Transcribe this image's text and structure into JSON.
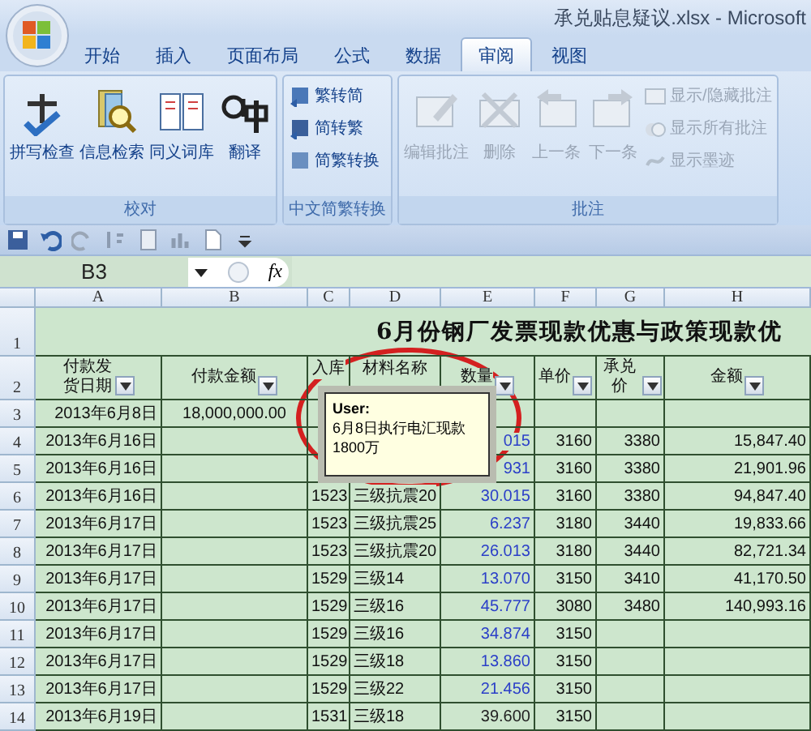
{
  "window": {
    "title": "承兑贴息疑议.xlsx - Microsoft"
  },
  "tabs": [
    {
      "label": "开始",
      "selected": false
    },
    {
      "label": "插入",
      "selected": false
    },
    {
      "label": "页面布局",
      "selected": false
    },
    {
      "label": "公式",
      "selected": false
    },
    {
      "label": "数据",
      "selected": false
    },
    {
      "label": "审阅",
      "selected": true
    },
    {
      "label": "视图",
      "selected": false
    }
  ],
  "ribbon": {
    "groups": [
      {
        "label": "校对",
        "large": [
          {
            "label": "拼写检查",
            "disabled": false
          },
          {
            "label": "信息检索",
            "disabled": false
          },
          {
            "label": "同义词库",
            "disabled": false
          },
          {
            "label": "翻译",
            "disabled": false
          }
        ]
      },
      {
        "label": "中文简繁转换",
        "small": [
          {
            "label": "繁转简",
            "disabled": false
          },
          {
            "label": "简转繁",
            "disabled": false
          },
          {
            "label": "简繁转换",
            "disabled": false
          }
        ]
      },
      {
        "label": "批注",
        "large": [
          {
            "label": "编辑批注",
            "disabled": true
          },
          {
            "label": "删除",
            "disabled": true
          },
          {
            "label": "上一条",
            "disabled": true
          },
          {
            "label": "下一条",
            "disabled": true
          }
        ],
        "small": [
          {
            "label": "显示/隐藏批注",
            "disabled": true
          },
          {
            "label": "显示所有批注",
            "disabled": true
          },
          {
            "label": "显示墨迹",
            "disabled": true
          }
        ]
      }
    ]
  },
  "formula_bar": {
    "name_box": "B3",
    "fx": "fx"
  },
  "sheet": {
    "columns": [
      "A",
      "B",
      "C",
      "D",
      "E",
      "F",
      "G",
      "H"
    ],
    "title_row": {
      "num": "1",
      "text": "6月份钢厂发票现款优惠与政策现款优"
    },
    "header_row": {
      "num": "2",
      "cells": [
        {
          "text": "付款发货日期",
          "filter": true
        },
        {
          "text": "付款金额",
          "filter": true
        },
        {
          "text": "入库",
          "filter": false
        },
        {
          "text": "材料名称",
          "filter": false
        },
        {
          "text": "数量",
          "filter": true
        },
        {
          "text": "单价",
          "filter": true
        },
        {
          "text": "承兑价",
          "filter": true
        },
        {
          "text": "金额",
          "filter": true
        }
      ]
    },
    "rows": [
      {
        "num": "3",
        "cells": [
          "2013年6月8日",
          "18,000,000.00",
          "",
          "",
          "",
          "",
          "",
          ""
        ]
      },
      {
        "num": "4",
        "cells": [
          "2013年6月16日",
          "",
          "",
          "",
          "015",
          "3160",
          "3380",
          "15,847.40"
        ],
        "quantity_highlighted": true
      },
      {
        "num": "5",
        "cells": [
          "2013年6月16日",
          "",
          "",
          "",
          "931",
          "3160",
          "3380",
          "21,901.96"
        ],
        "quantity_highlighted": true
      },
      {
        "num": "6",
        "cells": [
          "2013年6月16日",
          "",
          "1523",
          "三级抗震20",
          "30.015",
          "3160",
          "3380",
          "94,847.40"
        ],
        "quantity_highlighted": true
      },
      {
        "num": "7",
        "cells": [
          "2013年6月17日",
          "",
          "1523",
          "三级抗震25",
          "6.237",
          "3180",
          "3440",
          "19,833.66"
        ],
        "quantity_highlighted": true
      },
      {
        "num": "8",
        "cells": [
          "2013年6月17日",
          "",
          "1523",
          "三级抗震20",
          "26.013",
          "3180",
          "3440",
          "82,721.34"
        ],
        "quantity_highlighted": true
      },
      {
        "num": "9",
        "cells": [
          "2013年6月17日",
          "",
          "1529",
          "三级14",
          "13.070",
          "3150",
          "3410",
          "41,170.50"
        ],
        "quantity_highlighted": true
      },
      {
        "num": "10",
        "cells": [
          "2013年6月17日",
          "",
          "1529",
          "三级16",
          "45.777",
          "3080",
          "3480",
          "140,993.16"
        ],
        "quantity_highlighted": true
      },
      {
        "num": "11",
        "cells": [
          "2013年6月17日",
          "",
          "1529",
          "三级16",
          "34.874",
          "3150",
          "",
          ""
        ],
        "quantity_highlighted": true
      },
      {
        "num": "12",
        "cells": [
          "2013年6月17日",
          "",
          "1529",
          "三级18",
          "13.860",
          "3150",
          "",
          ""
        ],
        "quantity_highlighted": true
      },
      {
        "num": "13",
        "cells": [
          "2013年6月17日",
          "",
          "1529",
          "三级22",
          "21.456",
          "3150",
          "",
          ""
        ],
        "quantity_highlighted": true
      },
      {
        "num": "14",
        "cells": [
          "2013年6月19日",
          "",
          "1531",
          "三级18",
          "39.600",
          "3150",
          "",
          ""
        ],
        "quantity_highlighted": false
      }
    ],
    "comment": {
      "author": "User:",
      "text": "6月8日执行电汇现款1800万"
    }
  }
}
